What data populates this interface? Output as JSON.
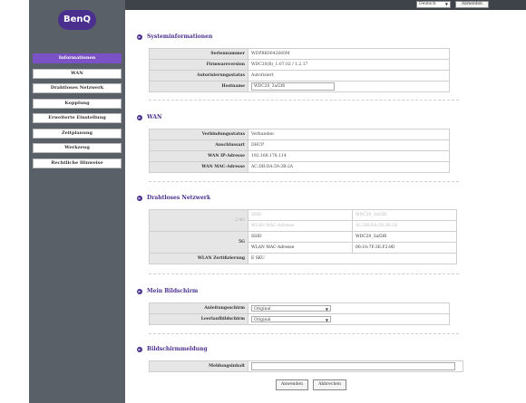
{
  "brand": {
    "logo_text": "BenQ",
    "color": "#4b2f8f"
  },
  "topbar": {
    "language": "Deutsch",
    "logout_label": "Abmelden"
  },
  "nav": [
    {
      "label": "Informationen",
      "active": true
    },
    {
      "label": "WAN"
    },
    {
      "label": "Drahtloses Netzwerk"
    },
    {
      "label": "Kopplung"
    },
    {
      "label": "Erweiterte Einstellung"
    },
    {
      "label": "Zeitplanung"
    },
    {
      "label": "Werkzeug"
    },
    {
      "label": "Rechtliche Hinweise"
    }
  ],
  "system": {
    "title": "Systeminformationen",
    "rows": [
      {
        "label": "Seriennummer",
        "value": "WDPBK0042660M"
      },
      {
        "label": "Firmwareversion",
        "value": "WDC20(R)_1.07.02 / 1.2.17"
      },
      {
        "label": "Autorisierungsstatus",
        "value": "Autorisiert"
      },
      {
        "label": "Hostname",
        "value": "WDC20_3af2f6"
      }
    ]
  },
  "wan": {
    "title": "WAN",
    "rows": [
      {
        "label": "Verbindungsstatus",
        "value": "Verbunden"
      },
      {
        "label": "Anschlussart",
        "value": "DHCP"
      },
      {
        "label": "WAN IP-Adresse",
        "value": "192.168.178.114"
      },
      {
        "label": "WAN MAC-Adresse",
        "value": "AC:DB:DA:59:3B:2A"
      }
    ]
  },
  "wireless": {
    "title": "Drahtloses Netzwerk",
    "band24": {
      "label": "2.4G",
      "ssid_key": "SSID",
      "ssid_value": "WDC20_3af2f6",
      "mac_key": "WLAN MAC-Adresse",
      "mac_value": "AC:DB:DA:59:3B:2A"
    },
    "band5": {
      "label": "5G",
      "ssid_key": "SSID",
      "ssid_value": "WDC20_3af2f6",
      "mac_key": "WLAN MAC-Adresse",
      "mac_value": "00:10:7F:3E:F2:9D"
    },
    "cert": {
      "label": "WLAN Zertifizierung",
      "value": "E SKU"
    }
  },
  "screen": {
    "title": "Mein Bildschirm",
    "rows": [
      {
        "label": "Anleitungsschirm",
        "value": "Original"
      },
      {
        "label": "Leerlaufbildschirm",
        "value": "Original"
      }
    ]
  },
  "message": {
    "title": "Bildschirmmeldung",
    "label": "Meldungsinhalt",
    "value": ""
  },
  "buttons": {
    "apply": "Anwenden",
    "cancel": "Abbrechen"
  }
}
